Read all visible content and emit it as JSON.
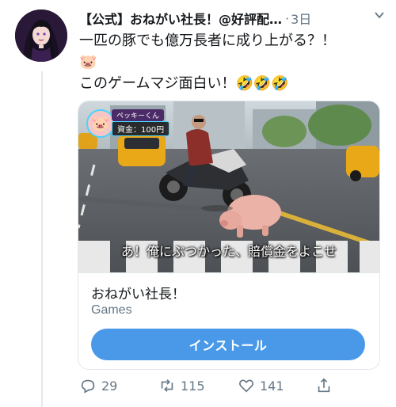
{
  "tweet": {
    "display_name": "【公式】おねがい社長！@好評配…",
    "separator": "·",
    "time": "3日",
    "lines": [
      "一匹の豚でも億万長者に成り上がる？！",
      "🐷",
      "このゲームマジ面白い！🤣🤣🤣"
    ],
    "pig_emoji": "🐷",
    "caret_icon": "chevron-down-icon"
  },
  "card": {
    "hud_name": "ペッキーくん",
    "hud_money": "資金：100円",
    "subtitle": "あ！俺にぶつかった、賠償金をよこせ",
    "title": "おねがい社長！",
    "category": "Games",
    "install_label": "インストール",
    "button_color": "#4a99e9"
  },
  "actions": {
    "replies": "29",
    "retweets": "115",
    "likes": "141"
  },
  "colors": {
    "muted": "#657786",
    "border": "#e1e8ed"
  }
}
